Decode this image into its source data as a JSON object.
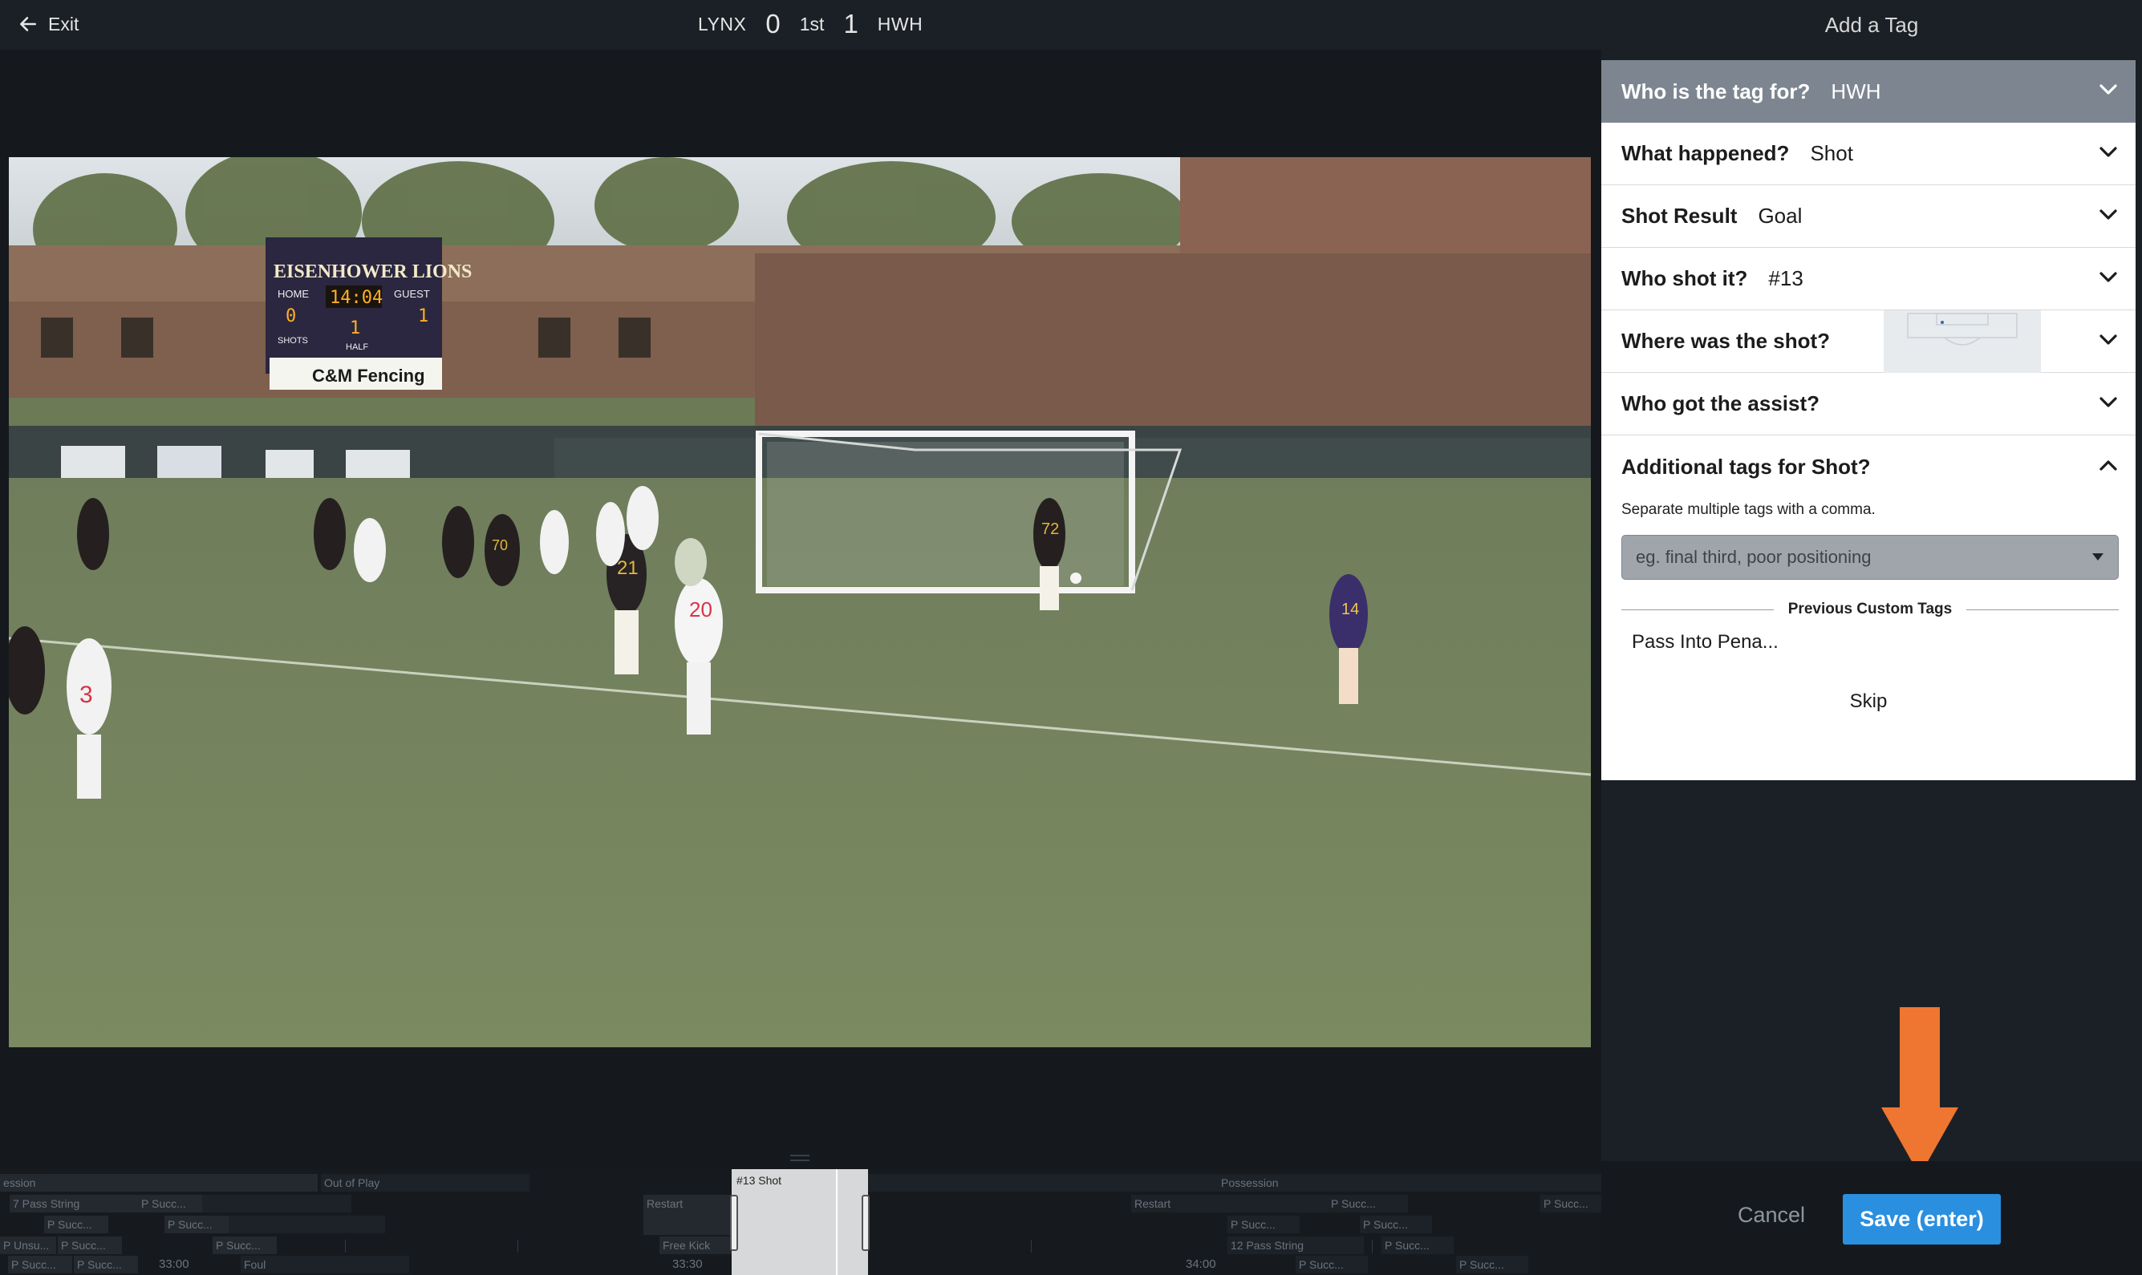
{
  "topbar": {
    "exit_label": "Exit",
    "home_team": "LYNX",
    "home_score": "0",
    "period": "1st",
    "away_score": "1",
    "away_team": "HWH"
  },
  "video": {
    "scoreboard_name": "EISENHOWER LIONS",
    "scoreboard_home": "HOME",
    "scoreboard_guest": "GUEST",
    "scoreboard_clock": "14:04",
    "scoreboard_shots": "SHOTS",
    "scoreboard_half": "HALF",
    "scoreboard_home_score": "0",
    "scoreboard_guest_score": "1",
    "scoreboard_half_value": "1",
    "sponsor": "C&M Fencing",
    "jersey_numbers": [
      "3",
      "20",
      "21",
      "72",
      "14",
      "70"
    ]
  },
  "timeline": {
    "rows": [
      {
        "label": "ession"
      },
      {
        "label": "Out of Play"
      },
      {
        "label": "7 Pass String"
      },
      {
        "label": "P Succ..."
      },
      {
        "label": "P Succ..."
      },
      {
        "label": "P Succ..."
      },
      {
        "label": "P Unsu..."
      },
      {
        "label": "P Succ..."
      },
      {
        "label": "P Succ..."
      },
      {
        "label": "P Succ..."
      },
      {
        "label": "P Succ..."
      },
      {
        "label": "Foul"
      },
      {
        "label": "Restart"
      },
      {
        "label": "Free Kick"
      },
      {
        "label": "Possession"
      },
      {
        "label": "Restart"
      },
      {
        "label": "P Succ..."
      },
      {
        "label": "P Succ..."
      },
      {
        "label": "P Succ..."
      },
      {
        "label": "12 Pass String"
      },
      {
        "label": "P Succ..."
      },
      {
        "label": "P Succ..."
      },
      {
        "label": "P Succ..."
      },
      {
        "label": "P Succ..."
      }
    ],
    "times": [
      "33:00",
      "33:30",
      "34:00"
    ],
    "clip_label": "#13 Shot"
  },
  "panel": {
    "title": "Add a Tag",
    "rows": [
      {
        "question": "Who is the tag for?",
        "answer": "HWH"
      },
      {
        "question": "What happened?",
        "answer": "Shot"
      },
      {
        "question": "Shot Result",
        "answer": "Goal"
      },
      {
        "question": "Who shot it?",
        "answer": "#13"
      },
      {
        "question": "Where was the shot?",
        "answer": ""
      },
      {
        "question": "Who got the assist?",
        "answer": ""
      }
    ],
    "additional": {
      "question": "Additional tags for Shot?",
      "hint": "Separate multiple tags with a comma.",
      "placeholder": "eg. final third, poor positioning",
      "previous_label": "Previous Custom Tags",
      "previous_tags": [
        "Pass Into Pena..."
      ],
      "skip_label": "Skip"
    }
  },
  "actions": {
    "cancel_label": "Cancel",
    "save_label": "Save (enter)"
  },
  "colors": {
    "save_button": "#2b8fe0",
    "annotation_arrow": "#ee7630",
    "active_row": "#7d8690"
  }
}
